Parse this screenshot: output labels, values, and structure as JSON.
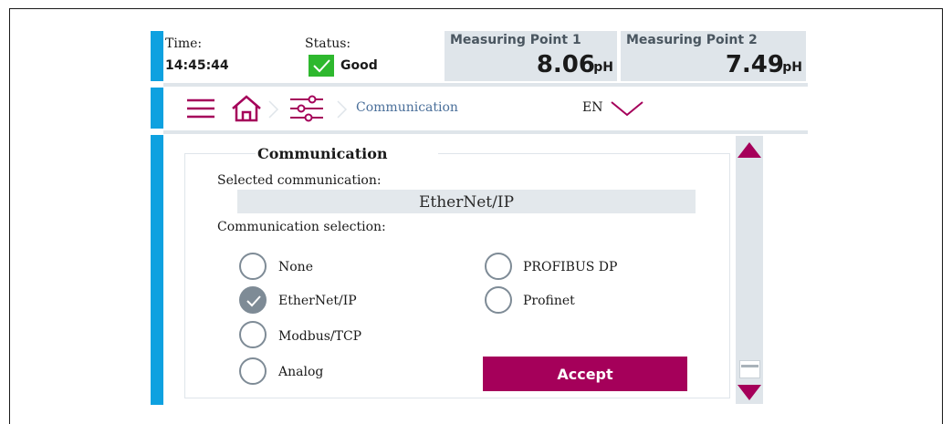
{
  "header": {
    "time_label": "Time:",
    "time_value": "14:45:44",
    "status_label": "Status:",
    "status_value": "Good",
    "status_icon": "check-icon",
    "measuring_points": [
      {
        "title": "Measuring Point 1",
        "value": "8.06",
        "unit": "pH"
      },
      {
        "title": "Measuring Point 2",
        "value": "7.49",
        "unit": "pH"
      }
    ]
  },
  "nav": {
    "menu_icon": "hamburger-menu-icon",
    "home_icon": "home-icon",
    "settings_icon": "sliders-icon",
    "breadcrumb": "Communication",
    "language": "EN"
  },
  "panel": {
    "title": "Communication",
    "selected_label": "Selected communication:",
    "selected_value": "EtherNet/IP",
    "selection_label": "Communication selection:",
    "options": [
      {
        "label": "None",
        "checked": false
      },
      {
        "label": "EtherNet/IP",
        "checked": true
      },
      {
        "label": "Modbus/TCP",
        "checked": false
      },
      {
        "label": "Analog",
        "checked": false
      },
      {
        "label": "PROFIBUS DP",
        "checked": false
      },
      {
        "label": "Profinet",
        "checked": false
      }
    ],
    "accept_label": "Accept"
  },
  "colors": {
    "accent": "#a5005a",
    "blue_bar": "#0ea1e0",
    "status_good": "#2eb82e",
    "panel_grey": "#dfe5ea"
  }
}
